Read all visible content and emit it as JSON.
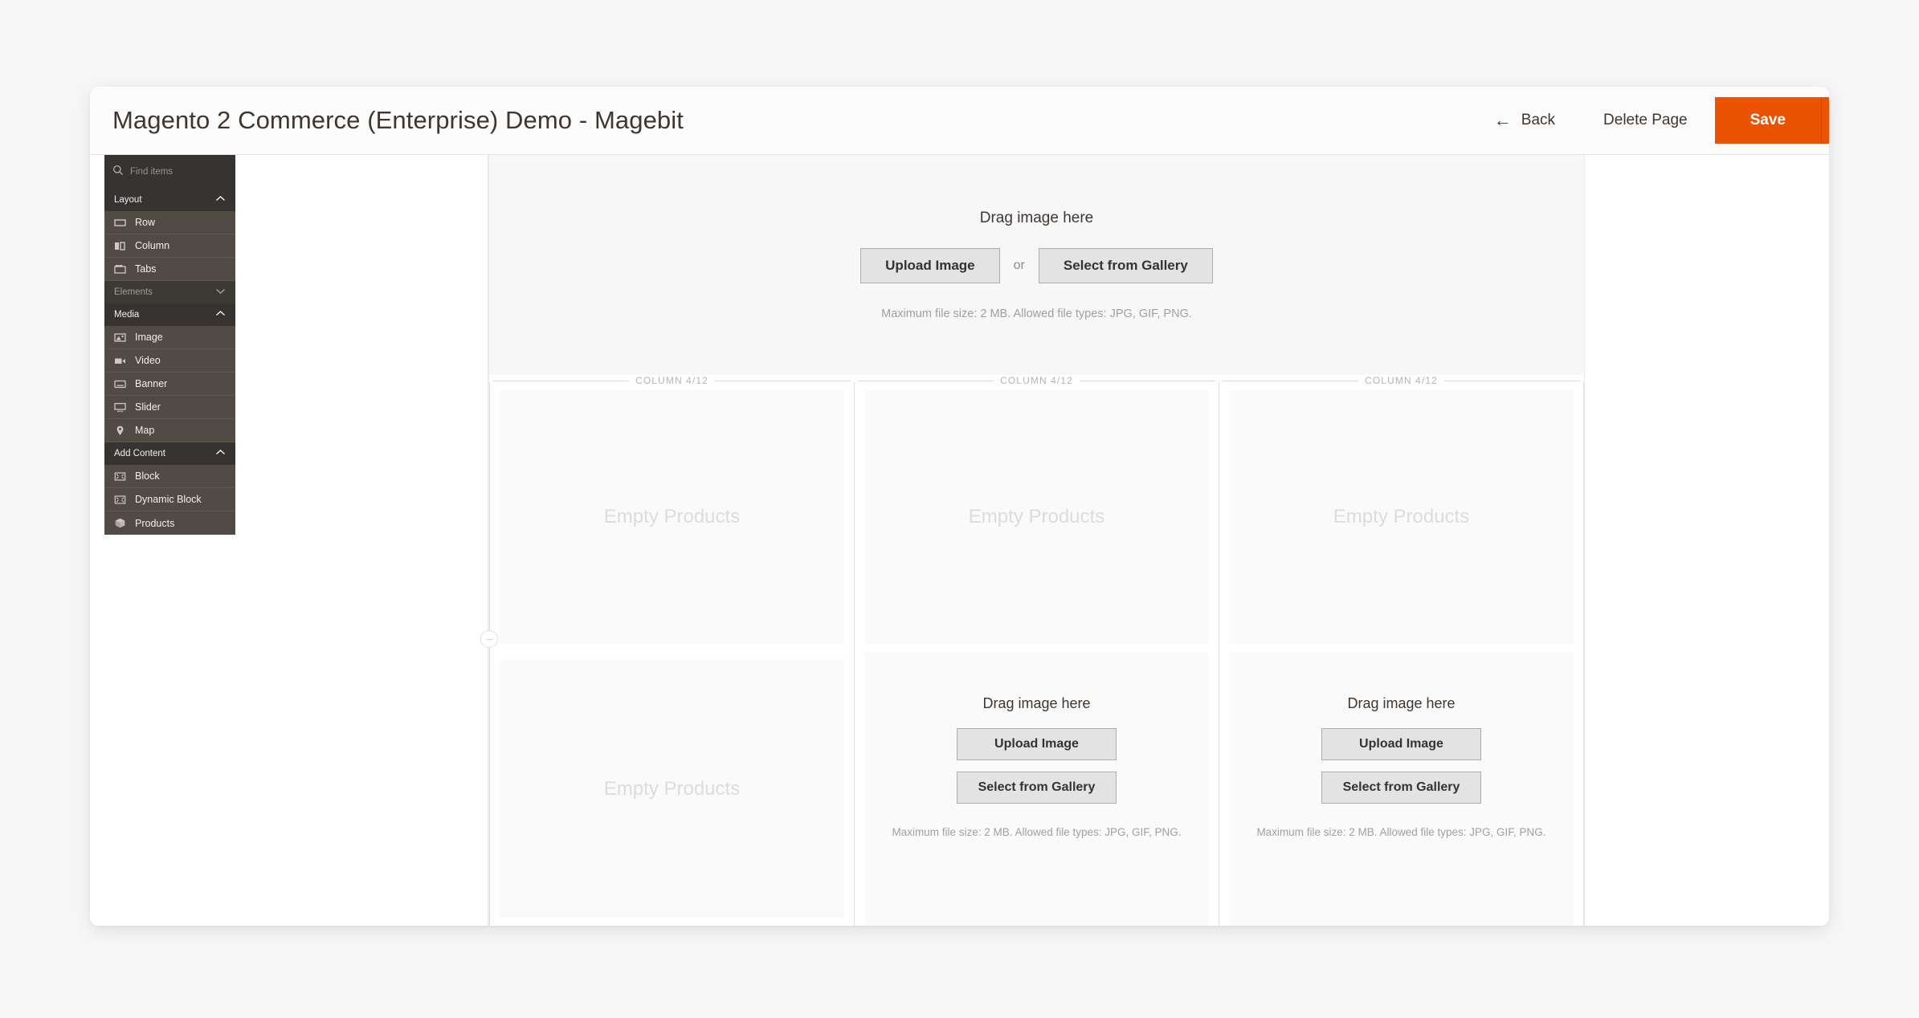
{
  "header": {
    "title": "Magento 2 Commerce (Enterprise) Demo - Magebit",
    "back_label": "Back",
    "back_icon": "arrow-left-icon",
    "delete_label": "Delete Page",
    "save_label": "Save",
    "accent_color": "#eb5202"
  },
  "sidebar": {
    "search": {
      "placeholder": "Find items",
      "value": "",
      "icon": "search-icon"
    },
    "sections": [
      {
        "label": "Layout",
        "expanded": true,
        "chevron": "chevron-up-icon",
        "items": [
          {
            "label": "Row",
            "icon": "row-icon"
          },
          {
            "label": "Column",
            "icon": "column-icon"
          },
          {
            "label": "Tabs",
            "icon": "tabs-icon"
          }
        ]
      },
      {
        "label": "Elements",
        "expanded": false,
        "chevron": "chevron-down-icon",
        "items": []
      },
      {
        "label": "Media",
        "expanded": true,
        "chevron": "chevron-up-icon",
        "items": [
          {
            "label": "Image",
            "icon": "image-icon"
          },
          {
            "label": "Video",
            "icon": "video-icon"
          },
          {
            "label": "Banner",
            "icon": "banner-icon"
          },
          {
            "label": "Slider",
            "icon": "slider-icon"
          },
          {
            "label": "Map",
            "icon": "map-pin-icon"
          }
        ]
      },
      {
        "label": "Add Content",
        "expanded": true,
        "chevron": "chevron-up-icon",
        "items": [
          {
            "label": "Block",
            "icon": "block-icon"
          },
          {
            "label": "Dynamic Block",
            "icon": "dynamic-block-icon"
          },
          {
            "label": "Products",
            "icon": "products-icon"
          }
        ]
      }
    ]
  },
  "canvas": {
    "top_image": {
      "drag_label": "Drag image here",
      "upload_label": "Upload Image",
      "or_label": "or",
      "gallery_label": "Select from Gallery",
      "hint": "Maximum file size: 2 MB. Allowed file types: JPG, GIF, PNG."
    },
    "columns": [
      {
        "label": "COLUMN 4/12",
        "blocks": [
          {
            "type": "empty-products",
            "label": "Empty Products"
          },
          {
            "type": "empty-products",
            "label": "Empty Products"
          }
        ]
      },
      {
        "label": "COLUMN 4/12",
        "blocks": [
          {
            "type": "empty-products",
            "label": "Empty Products"
          },
          {
            "type": "image-uploader",
            "drag_label": "Drag image here",
            "upload_label": "Upload Image",
            "gallery_label": "Select from Gallery",
            "hint": "Maximum file size: 2 MB. Allowed file types: JPG, GIF, PNG."
          }
        ]
      },
      {
        "label": "COLUMN 4/12",
        "blocks": [
          {
            "type": "empty-products",
            "label": "Empty Products"
          },
          {
            "type": "image-uploader",
            "drag_label": "Drag image here",
            "upload_label": "Upload Image",
            "gallery_label": "Select from Gallery",
            "hint": "Maximum file size: 2 MB. Allowed file types: JPG, GIF, PNG."
          }
        ]
      }
    ]
  }
}
